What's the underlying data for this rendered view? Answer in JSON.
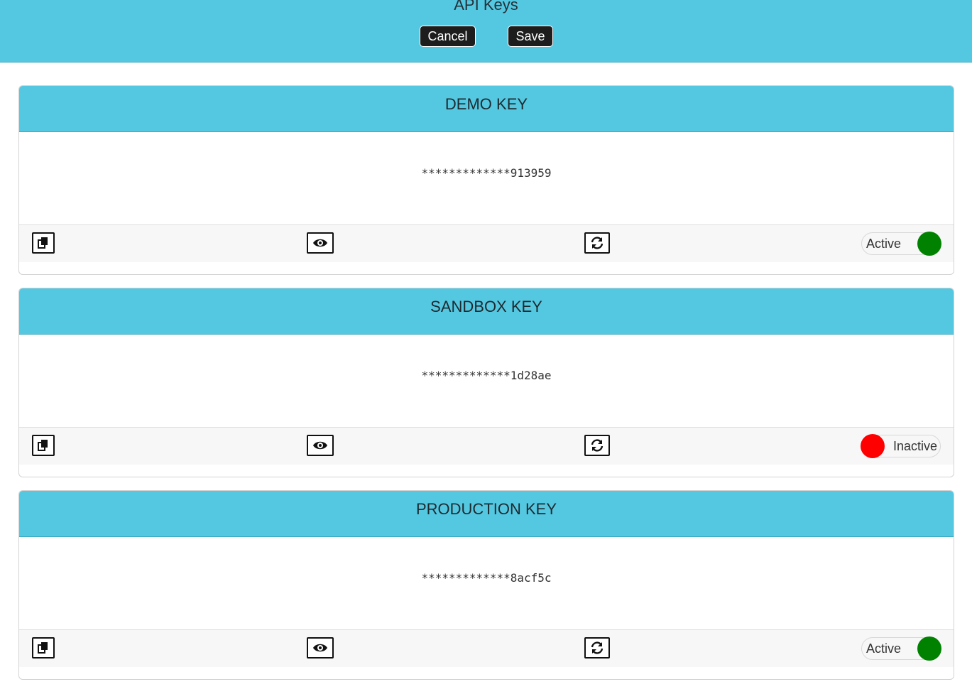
{
  "header": {
    "title": "API Keys",
    "cancel_label": "Cancel",
    "save_label": "Save"
  },
  "colors": {
    "header_bg": "#55c8e1",
    "active": "#008200",
    "inactive": "#ff0000"
  },
  "keys": [
    {
      "title": "DEMO KEY",
      "masked_value": "*************913959",
      "status": "Active",
      "active": true
    },
    {
      "title": "SANDBOX KEY",
      "masked_value": "*************1d28ae",
      "status": "Inactive",
      "active": false
    },
    {
      "title": "PRODUCTION KEY",
      "masked_value": "*************8acf5c",
      "status": "Active",
      "active": true
    }
  ],
  "icons": {
    "copy": "copy-icon",
    "view": "eye-icon",
    "refresh": "refresh-icon"
  }
}
